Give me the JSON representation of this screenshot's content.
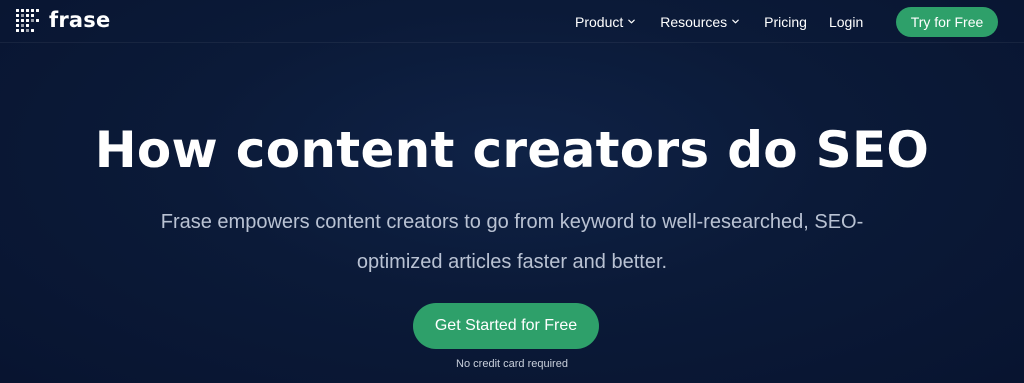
{
  "header": {
    "logo_text": "frase",
    "nav": {
      "product": "Product",
      "resources": "Resources",
      "pricing": "Pricing",
      "login": "Login"
    },
    "cta_label": "Try for Free"
  },
  "hero": {
    "title": "How content creators do SEO",
    "subtitle": "Frase empowers content creators to go from keyword to well-researched, SEO-optimized articles faster and better.",
    "cta_label": "Get Started for Free",
    "note": "No credit card required"
  },
  "colors": {
    "background": "#0b1a38",
    "accent_green": "#2ea06a",
    "text_primary": "#ffffff",
    "text_muted": "#b9c2d3"
  },
  "icons": {
    "logo": "frase-logo-icon",
    "dropdown": "chevron-down-icon"
  }
}
